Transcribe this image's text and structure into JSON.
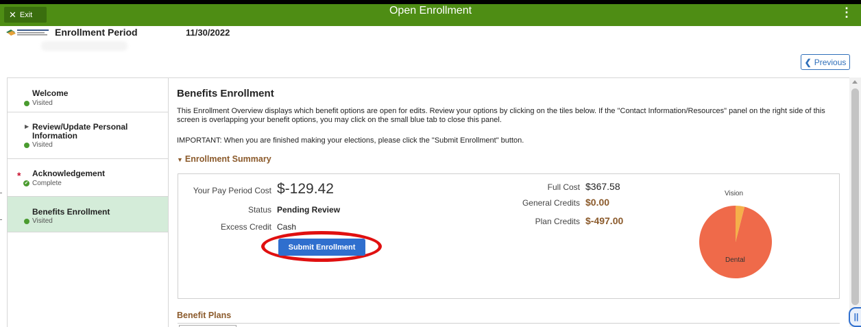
{
  "titlebar": {
    "exit_label": "Exit",
    "title": "Open Enrollment",
    "menu_glyph": "⋮"
  },
  "header": {
    "enrollment_label": "Enrollment Period",
    "enrollment_date": "11/30/2022",
    "previous_label": "Previous"
  },
  "nav": {
    "items": [
      {
        "label": "Welcome",
        "status": "Visited"
      },
      {
        "label": "Review/Update Personal Information",
        "status": "Visited"
      },
      {
        "label": "Acknowledgement",
        "status": "Complete"
      },
      {
        "label": "Benefits Enrollment",
        "status": "Visited"
      }
    ]
  },
  "main": {
    "title": "Benefits Enrollment",
    "description": "This Enrollment Overview displays which benefit options are open for edits. Review your options by clicking on the tiles below. If the \"Contact Information/Resources\" panel on the right side of this screen is overlapping your benefit options, you may click on the small blue tab to close this panel.",
    "important": "IMPORTANT: When you are finished making your elections, please click the \"Submit Enrollment\" button.",
    "summary_heading": "Enrollment Summary",
    "plans_heading": "Benefit Plans"
  },
  "summary": {
    "pay_period_label": "Your Pay Period Cost",
    "pay_period_value": "$-129.42",
    "status_label": "Status",
    "status_value": "Pending Review",
    "excess_label": "Excess Credit",
    "excess_value": "Cash",
    "full_cost_label": "Full Cost",
    "full_cost_value": "$367.58",
    "general_credits_label": "General Credits",
    "general_credits_value": "$0.00",
    "plan_credits_label": "Plan Credits",
    "plan_credits_value": "$-497.00",
    "submit_label": "Submit Enrollment"
  },
  "pie": {
    "slices": [
      {
        "label": "Dental",
        "fraction": 0.96,
        "color": "#ef6a4a"
      },
      {
        "label": "Vision",
        "fraction": 0.04,
        "color": "#f5b04a"
      }
    ]
  },
  "colors": {
    "titlebar": "#4e8d14",
    "accent_blue": "#2f6fce",
    "brown": "#8b5a2b",
    "highlight_ring": "#e01010",
    "active_nav": "#d4ecd9"
  }
}
